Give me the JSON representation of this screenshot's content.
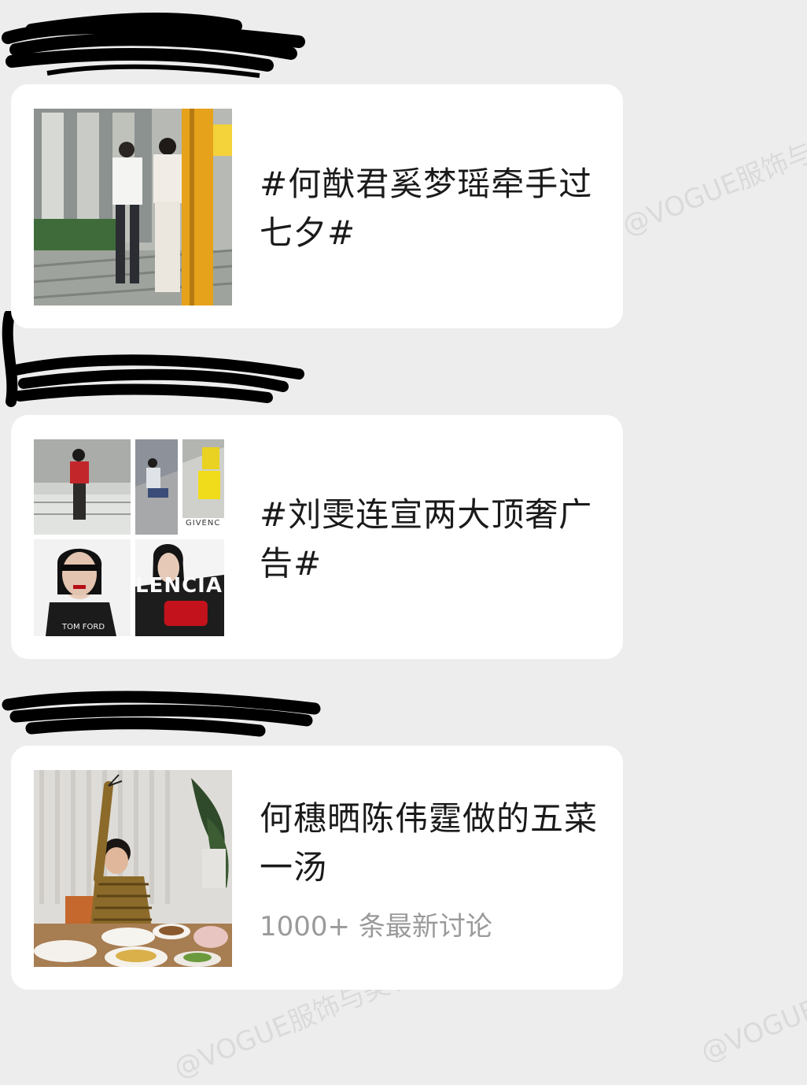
{
  "watermark": "@VOGUE服饰与美容",
  "cards": [
    {
      "title": "#何猷君奚梦瑶牵手过七夕#",
      "thumb": "photo-couple-street"
    },
    {
      "title": "#刘雯连宣两大顶奢广告#",
      "thumb": "photo-fashion-collage",
      "collage_texts": {
        "givenchy": "GIVENC",
        "tomford": "TOM FORD",
        "balenciaga": "LENCIA"
      }
    },
    {
      "title": "何穗晒陈伟霆做的五菜一汤",
      "subtitle": "1000+ 条最新讨论",
      "thumb": "photo-dinner-table"
    }
  ],
  "colors": {
    "background": "#ededed",
    "card": "#ffffff",
    "title": "#1a1a1a",
    "subtitle": "#9a9a9a"
  }
}
